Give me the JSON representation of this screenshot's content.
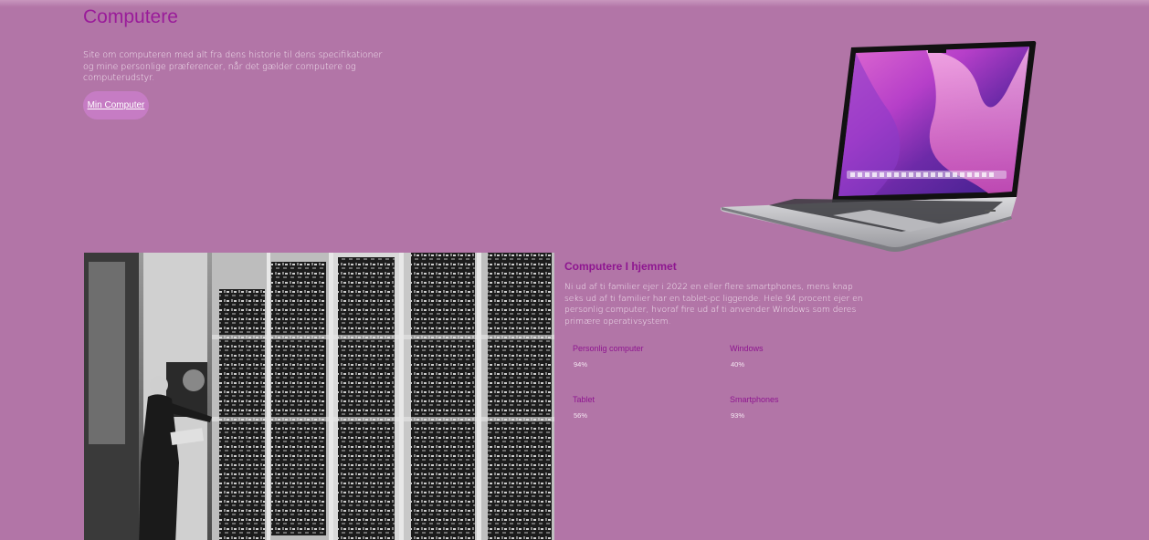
{
  "hero": {
    "title": "Computere",
    "description": "Site om computeren med alt fra dens historie til dens specifikationer og mine personlige præferencer, når det gælder computere og computerudstyr.",
    "button_label": "Min Computer"
  },
  "section": {
    "title": "Computere I hjemmet",
    "description": "Ni ud af ti familier ejer i 2022 en eller flere smartphones, mens knap seks ud af ti familier har en tablet-pc liggende. Hele 94 procent ejer en personlig computer, hvoraf fire ud af ti anvender Windows som deres primære operativsystem."
  },
  "stats": [
    {
      "label": "Personlig computer",
      "value": "94%"
    },
    {
      "label": "Windows",
      "value": "40%"
    },
    {
      "label": "Tablet",
      "value": "56%"
    },
    {
      "label": "Smartphones",
      "value": "93%"
    }
  ],
  "colors": {
    "background": "#b275a7",
    "accent": "#8e1690",
    "button": "#c67cc4"
  }
}
